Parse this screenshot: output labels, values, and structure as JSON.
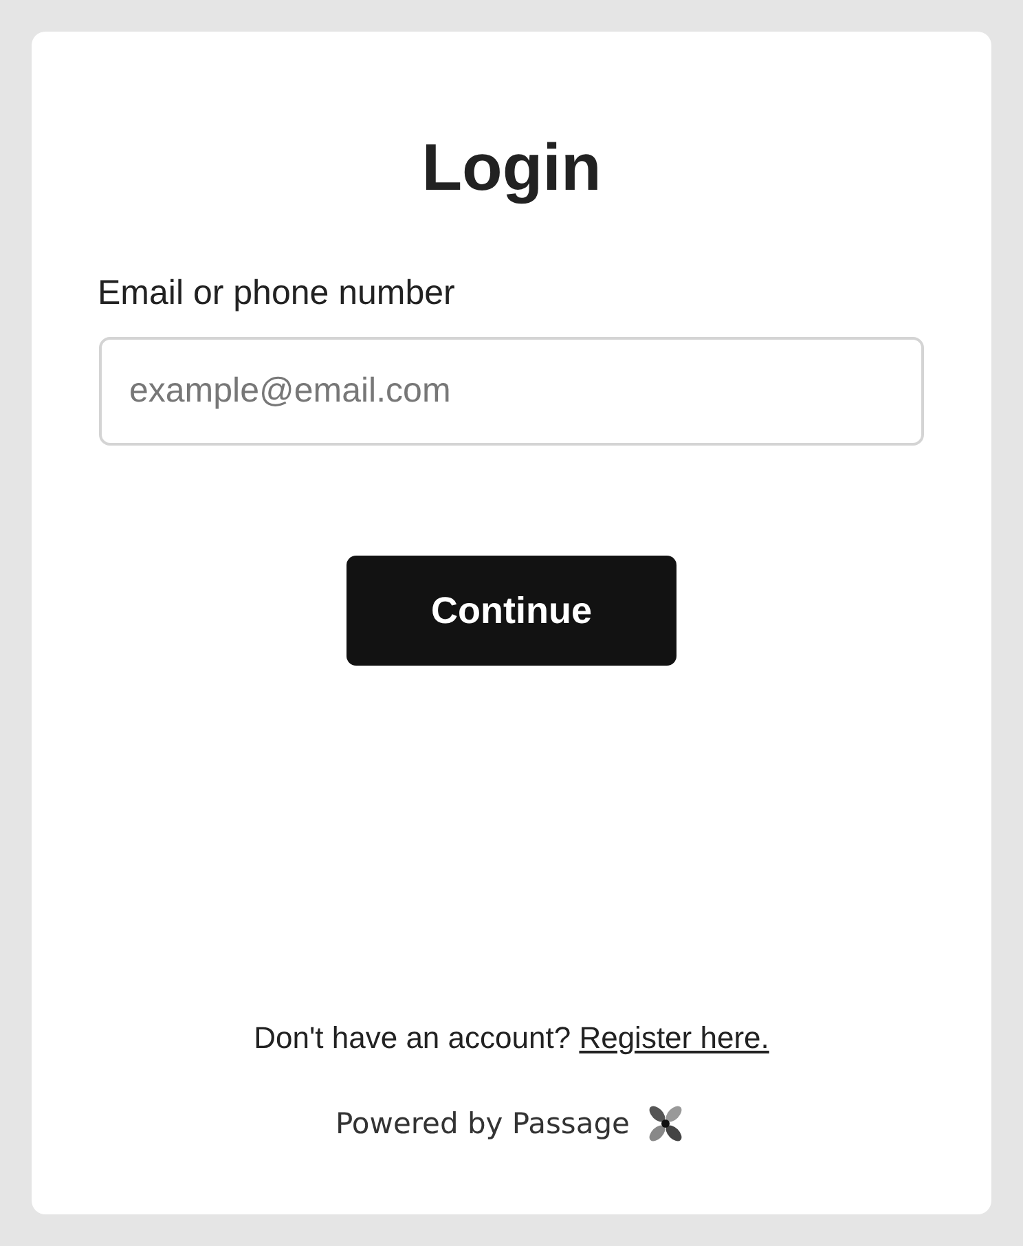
{
  "title": "Login",
  "field": {
    "label": "Email or phone number",
    "placeholder": "example@email.com"
  },
  "button": "Continue",
  "footer": {
    "prompt": "Don't have an account?",
    "link": "Register here."
  },
  "powered_by": "Powered by Passage"
}
